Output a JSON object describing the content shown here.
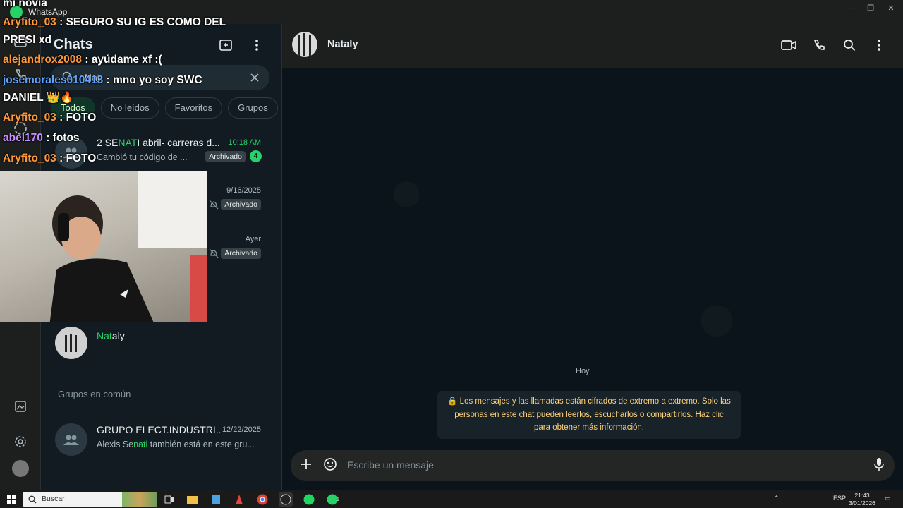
{
  "window": {
    "title": "WhatsApp",
    "controls": [
      "minimize",
      "maximize",
      "close"
    ]
  },
  "rail": {
    "items": [
      {
        "icon": "chats-icon",
        "badge": "1"
      },
      {
        "icon": "calls-icon"
      },
      {
        "icon": "status-icon"
      },
      {
        "icon": "channels-icon"
      },
      {
        "icon": "communities-icon"
      }
    ],
    "bottom": [
      {
        "icon": "media-icon"
      },
      {
        "icon": "settings-icon"
      },
      {
        "icon": "profile-avatar"
      }
    ]
  },
  "panel": {
    "title": "Chats",
    "search_value": "Nat",
    "filters": [
      {
        "label": "Todos",
        "active": true
      },
      {
        "label": "No leídos"
      },
      {
        "label": "Favoritos"
      },
      {
        "label": "Grupos"
      }
    ],
    "chats": [
      {
        "name_pre": "2 SE",
        "name_hl": "NAT",
        "name_post": "I  abril- carreras d...",
        "time": "10:18 AM",
        "preview": "Cambió tu código de ...",
        "archived": "Archivado",
        "count": "4"
      },
      {
        "time": "9/16/2025",
        "archived": "Archivado"
      },
      {
        "time": "Ayer",
        "archived": "Archivado"
      }
    ],
    "contact": {
      "name_hl": "Nat",
      "name_post": "aly"
    },
    "groups_title": "Grupos en común",
    "group": {
      "name": "GRUPO ELECT.INDUSTRI...",
      "time": "12/22/2025",
      "preview_pre": "Alexis Se",
      "preview_hl": "nati",
      "preview_post": " también está en este gru..."
    }
  },
  "overlay": {
    "lines": [
      {
        "user": "",
        "text": "mi novia"
      },
      {
        "user": "Aryfito_03",
        "text": " : SEGURO SU IG ES COMO DEL"
      },
      {
        "user": "",
        "text": "PRESI xd"
      },
      {
        "user": "alejandrox2008",
        "text": " : ayúdame xf :("
      },
      {
        "user": "josemorales010413",
        "text": " : mno yo soy SWC"
      },
      {
        "user": "",
        "text": "DANIEL 👑🔥"
      },
      {
        "user": "Aryfito_03",
        "text": " : FOTO"
      },
      {
        "user": "abel170",
        "text": " : fotos"
      },
      {
        "user": "Aryfito_03",
        "text": " : FOTO"
      }
    ]
  },
  "conversation": {
    "contact_name": "Nataly",
    "day": "Hoy",
    "system_message": "🔒 Los mensajes y las llamadas están cifrados de extremo a extremo. Solo las personas en este chat pueden leerlos, escucharlos o compartirlos. Haz clic para obtener más información.",
    "input_placeholder": "Escribe un mensaje"
  },
  "taskbar": {
    "search_placeholder": "Buscar",
    "apps": [
      "task-view-icon",
      "file-explorer-icon",
      "notepad-icon",
      "app-icon",
      "chrome-icon",
      "obs-icon",
      "spotify-icon",
      "whatsapp-icon"
    ],
    "whatsapp_count": "1",
    "language": "ESP",
    "time": "21:43",
    "date": "3/01/2026",
    "notifications": "2"
  },
  "colors": {
    "accent": "#25d366",
    "panel": "#111b21",
    "background": "#0b141a",
    "system_text": "#ffd279"
  }
}
